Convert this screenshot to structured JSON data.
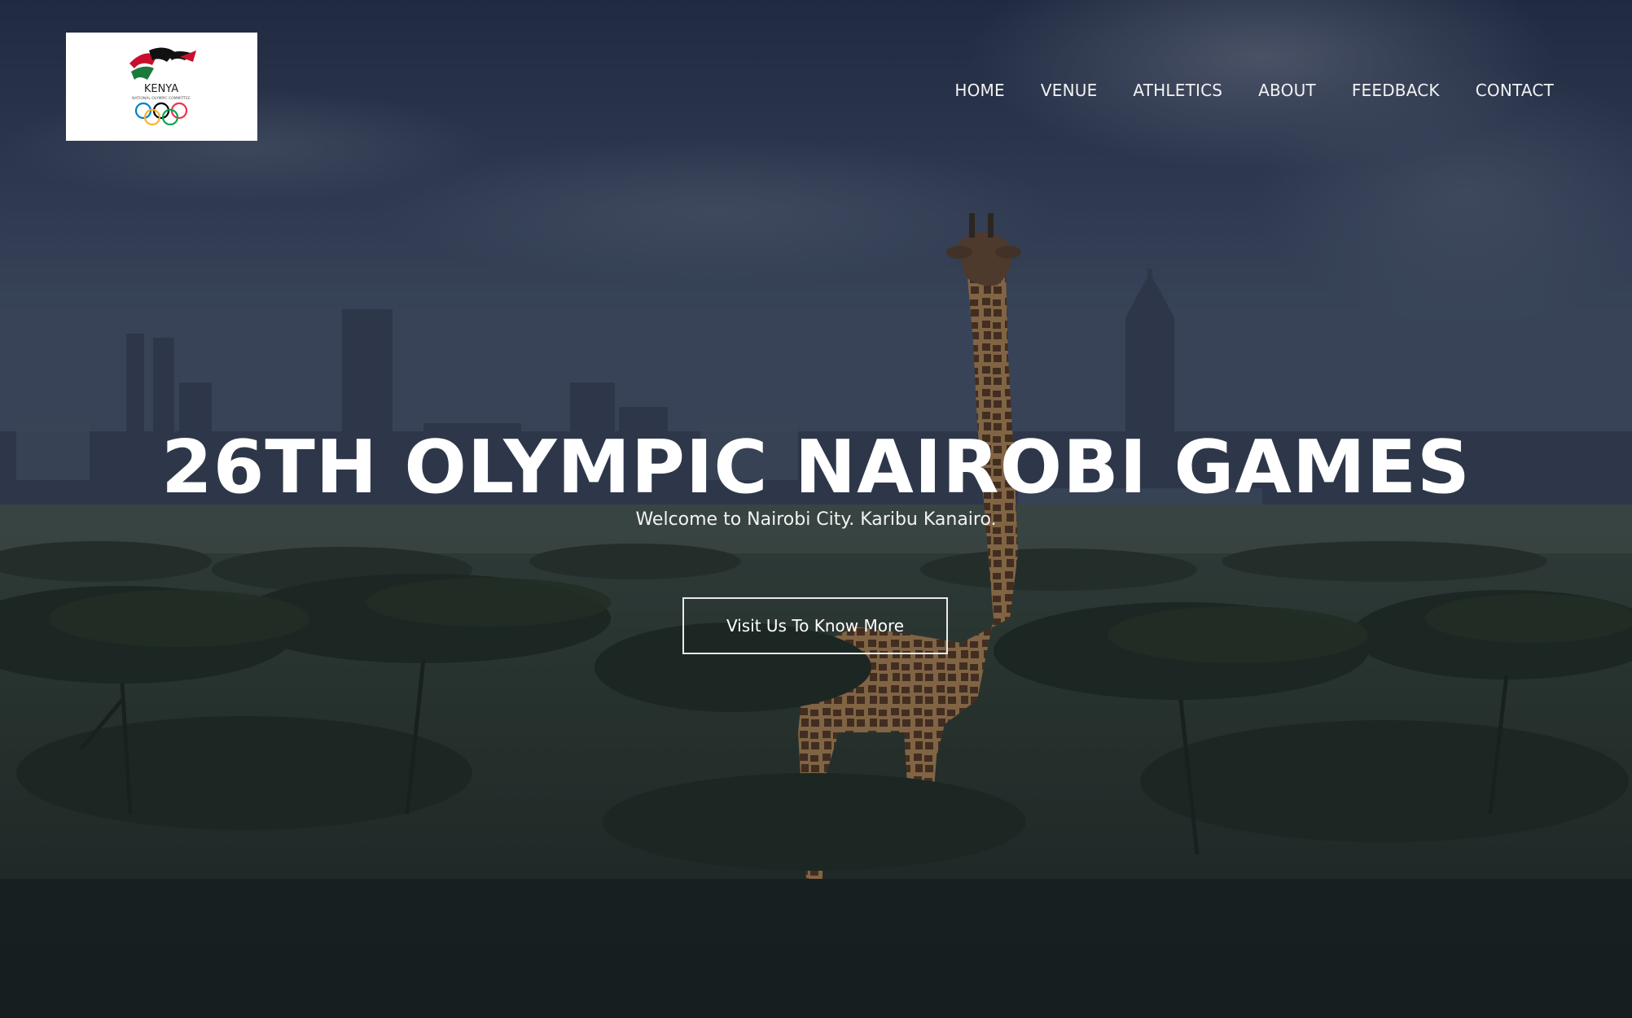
{
  "header": {
    "logo": {
      "text": "KENYA",
      "subtitle": "NATIONAL OLYMPIC COMMITTEE"
    },
    "nav": [
      {
        "label": "HOME"
      },
      {
        "label": "VENUE"
      },
      {
        "label": "ATHLETICS"
      },
      {
        "label": "ABOUT"
      },
      {
        "label": "FEEDBACK"
      },
      {
        "label": "CONTACT"
      }
    ]
  },
  "hero": {
    "title": "26TH OLYMPIC NAIROBI GAMES",
    "subtitle": "Welcome to Nairobi City. Karibu Kanairo.",
    "cta_label": "Visit Us To Know More"
  },
  "colors": {
    "text": "#ffffff",
    "overlay": "#1e2636",
    "kenya_red": "#c8102e",
    "kenya_green": "#1a7a3c",
    "kenya_black": "#111111"
  }
}
